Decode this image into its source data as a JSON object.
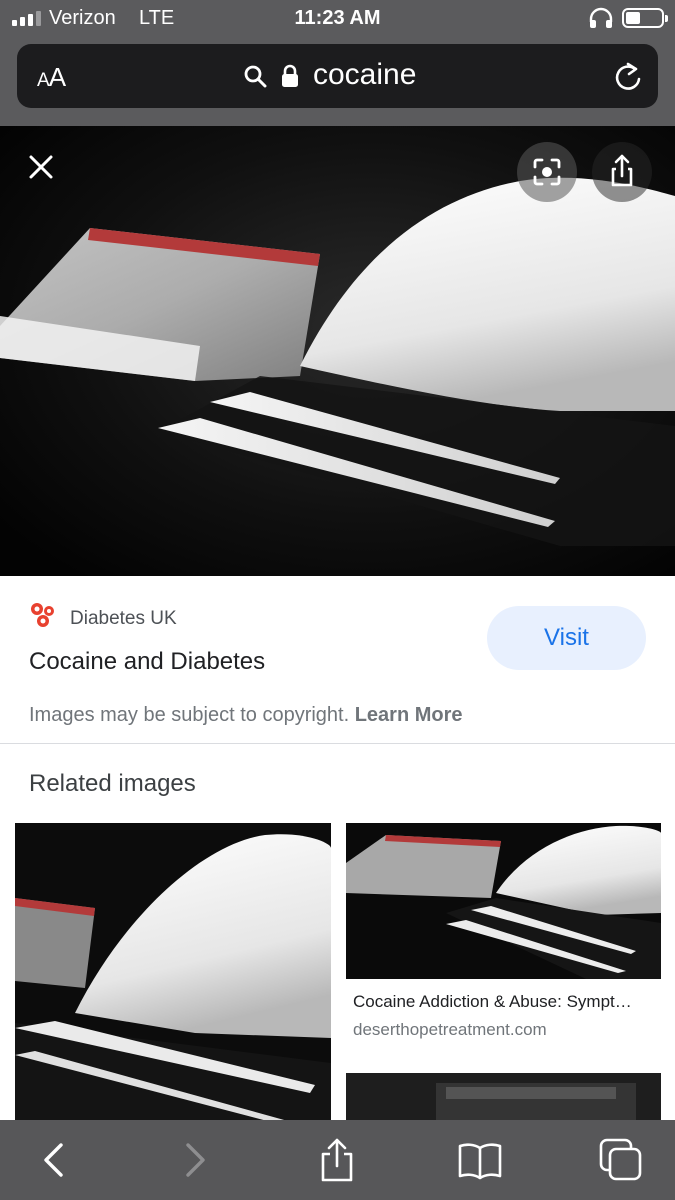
{
  "status_bar": {
    "carrier": "Verizon",
    "network": "LTE",
    "time": "11:23 AM"
  },
  "url_bar": {
    "text_size_label": "AA",
    "url": "cocaine",
    "icons": [
      "search-icon",
      "lock-icon",
      "reload-icon"
    ]
  },
  "image_viewer": {
    "icons": [
      "close-icon",
      "lens-icon",
      "share-icon"
    ]
  },
  "source": {
    "site_name": "Diabetes UK",
    "page_title": "Cocaine and Diabetes",
    "visit_label": "Visit",
    "copyright_text": "Images may be subject to copyright.",
    "learn_more_label": "Learn More"
  },
  "related": {
    "heading": "Related images",
    "items": [
      {
        "title": "",
        "domain": ""
      },
      {
        "title": "Cocaine Addiction & Abuse: Sympt…",
        "domain": "deserthopetreatment.com"
      },
      {
        "title": "",
        "domain": ""
      }
    ]
  },
  "toolbar": {
    "icons": [
      "back-icon",
      "forward-icon",
      "share-icon",
      "bookmarks-icon",
      "tabs-icon"
    ]
  },
  "colors": {
    "chrome": "#5b5b5d",
    "url_bar": "#1c1c1e",
    "accent": "#1a73e8",
    "visit_bg": "#e8f0fe"
  }
}
